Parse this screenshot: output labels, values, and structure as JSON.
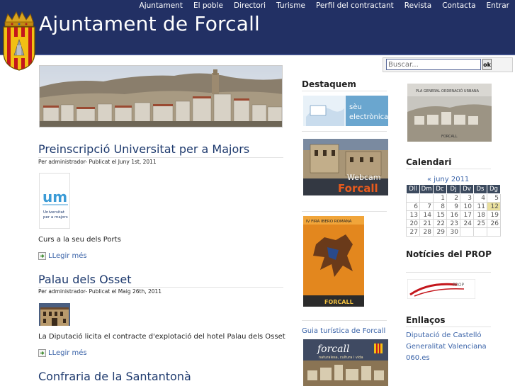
{
  "nav": {
    "items": [
      "Ajuntament",
      "El poble",
      "Directori",
      "Turisme",
      "Perfil del contractant",
      "Revista",
      "Contacta",
      "Entrar"
    ]
  },
  "site": {
    "title": "Ajuntament de Forcall"
  },
  "search": {
    "placeholder": "Buscar...",
    "button_label": "ok"
  },
  "posts": [
    {
      "title": "Preinscripció Universitat per a Majors",
      "meta": "Per administrador- Publicat el Juny 1st, 2011",
      "thumb_text": "Universitat per a majors",
      "excerpt": "Curs a la seu dels Ports",
      "readmore": "LLegir més"
    },
    {
      "title": "Palau dels Osset",
      "meta": "Per administrador- Publicat el Maig 26th, 2011",
      "excerpt": "La Diputació licita el contracte d'explotació del hotel Palau dels Osset",
      "readmore": "LLegir més"
    },
    {
      "title": "Confraria de la Santantonà"
    }
  ],
  "destaquem": {
    "heading": "Destaquem",
    "seu_label": "sèu electrònica",
    "webcam_label": "Webcam",
    "webcam_place": "Forcall",
    "poster_title": "IV FIRA IBERO ROMANA",
    "poster_place": "FORCALL",
    "guide_link": "Guia turística de Forcall",
    "guide_cover_title": "forcall",
    "guide_cover_subtitle": "naturalesa, cultura i vida"
  },
  "right": {
    "plan_label": "PLA GENERAL ORDENACIÓ URBANA",
    "plan_place": "FORCALL",
    "calendar_heading": "Calendari",
    "calendar_caption": "« juny 2011",
    "weekdays": [
      "Dll",
      "Dm",
      "Dc",
      "Dj",
      "Dv",
      "Ds",
      "Dg"
    ],
    "weeks": [
      [
        "",
        "",
        "1",
        "2",
        "3",
        "4",
        "5"
      ],
      [
        "6",
        "7",
        "8",
        "9",
        "10",
        "11",
        "12"
      ],
      [
        "13",
        "14",
        "15",
        "16",
        "17",
        "18",
        "19"
      ],
      [
        "20",
        "21",
        "22",
        "23",
        "24",
        "25",
        "26"
      ],
      [
        "27",
        "28",
        "29",
        "30",
        "",
        "",
        ""
      ]
    ],
    "today": "12",
    "prop_heading": "Notícies del PROP",
    "prop_logo": "PROP",
    "links_heading": "Enllaços",
    "links": [
      "Diputació de Castelló",
      "Generalitat Valenciana",
      "060.es"
    ]
  },
  "colors": {
    "header": "#223064",
    "title_link": "#1e3a6e",
    "link": "#3a63a8",
    "calendar_head": "#3c4a5e",
    "today": "#e9df9d"
  }
}
